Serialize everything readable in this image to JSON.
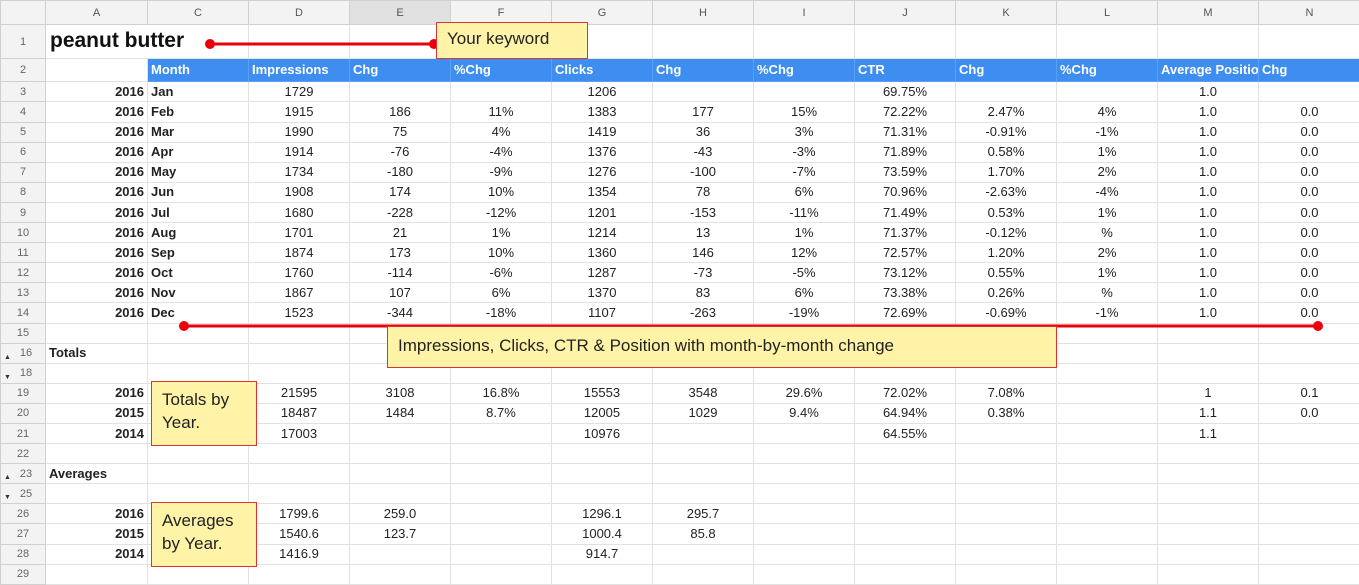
{
  "columns": [
    "A",
    "B",
    "C",
    "D",
    "E",
    "F",
    "G",
    "H",
    "I",
    "J",
    "K",
    "L",
    "M",
    "N"
  ],
  "row_numbers": [
    "1",
    "2",
    "3",
    "4",
    "5",
    "6",
    "7",
    "8",
    "9",
    "10",
    "11",
    "12",
    "13",
    "14",
    "15",
    "16",
    "18",
    "19",
    "20",
    "21",
    "22",
    "23",
    "25",
    "26",
    "27",
    "28",
    "29"
  ],
  "keyword": "peanut butter",
  "headers": [
    "Month",
    "Impressions",
    "Chg",
    "%Chg",
    "Clicks",
    "Chg",
    "%Chg",
    "CTR",
    "Chg",
    "%Chg",
    "Average Position",
    "Chg"
  ],
  "monthly_rows": [
    {
      "year": "2016",
      "month": "Jan",
      "cells": [
        "1729",
        "",
        "",
        "1206",
        "",
        "",
        "69.75%",
        "",
        "",
        "1.0",
        ""
      ]
    },
    {
      "year": "2016",
      "month": "Feb",
      "cells": [
        "1915",
        "186",
        "11%",
        "1383",
        "177",
        "15%",
        "72.22%",
        "2.47%",
        "4%",
        "1.0",
        "0.0"
      ]
    },
    {
      "year": "2016",
      "month": "Mar",
      "cells": [
        "1990",
        "75",
        "4%",
        "1419",
        "36",
        "3%",
        "71.31%",
        "-0.91%",
        "-1%",
        "1.0",
        "0.0"
      ]
    },
    {
      "year": "2016",
      "month": "Apr",
      "cells": [
        "1914",
        "-76",
        "-4%",
        "1376",
        "-43",
        "-3%",
        "71.89%",
        "0.58%",
        "1%",
        "1.0",
        "0.0"
      ]
    },
    {
      "year": "2016",
      "month": "May",
      "cells": [
        "1734",
        "-180",
        "-9%",
        "1276",
        "-100",
        "-7%",
        "73.59%",
        "1.70%",
        "2%",
        "1.0",
        "0.0"
      ]
    },
    {
      "year": "2016",
      "month": "Jun",
      "cells": [
        "1908",
        "174",
        "10%",
        "1354",
        "78",
        "6%",
        "70.96%",
        "-2.63%",
        "-4%",
        "1.0",
        "0.0"
      ]
    },
    {
      "year": "2016",
      "month": "Jul",
      "cells": [
        "1680",
        "-228",
        "-12%",
        "1201",
        "-153",
        "-11%",
        "71.49%",
        "0.53%",
        "1%",
        "1.0",
        "0.0"
      ]
    },
    {
      "year": "2016",
      "month": "Aug",
      "cells": [
        "1701",
        "21",
        "1%",
        "1214",
        "13",
        "1%",
        "71.37%",
        "-0.12%",
        "%",
        "1.0",
        "0.0"
      ]
    },
    {
      "year": "2016",
      "month": "Sep",
      "cells": [
        "1874",
        "173",
        "10%",
        "1360",
        "146",
        "12%",
        "72.57%",
        "1.20%",
        "2%",
        "1.0",
        "0.0"
      ]
    },
    {
      "year": "2016",
      "month": "Oct",
      "cells": [
        "1760",
        "-114",
        "-6%",
        "1287",
        "-73",
        "-5%",
        "73.12%",
        "0.55%",
        "1%",
        "1.0",
        "0.0"
      ]
    },
    {
      "year": "2016",
      "month": "Nov",
      "cells": [
        "1867",
        "107",
        "6%",
        "1370",
        "83",
        "6%",
        "73.38%",
        "0.26%",
        "%",
        "1.0",
        "0.0"
      ]
    },
    {
      "year": "2016",
      "month": "Dec",
      "cells": [
        "1523",
        "-344",
        "-18%",
        "1107",
        "-263",
        "-19%",
        "72.69%",
        "-0.69%",
        "-1%",
        "1.0",
        "0.0"
      ]
    }
  ],
  "totals_label": "Totals",
  "totals_rows": [
    {
      "year": "2016",
      "cells": [
        "21595",
        "3108",
        "16.8%",
        "15553",
        "3548",
        "29.6%",
        "72.02%",
        "7.08%",
        "",
        "1",
        "0.1"
      ]
    },
    {
      "year": "2015",
      "cells": [
        "18487",
        "1484",
        "8.7%",
        "12005",
        "1029",
        "9.4%",
        "64.94%",
        "0.38%",
        "",
        "1.1",
        "0.0"
      ]
    },
    {
      "year": "2014",
      "cells": [
        "17003",
        "",
        "",
        "10976",
        "",
        "",
        "64.55%",
        "",
        "",
        "1.1",
        ""
      ]
    }
  ],
  "averages_label": "Averages",
  "averages_rows": [
    {
      "year": "2016",
      "cells": [
        "1799.6",
        "259.0",
        "",
        "1296.1",
        "295.7",
        "",
        "",
        "",
        "",
        "",
        ""
      ]
    },
    {
      "year": "2015",
      "cells": [
        "1540.6",
        "123.7",
        "",
        "1000.4",
        "85.8",
        "",
        "",
        "",
        "",
        "",
        ""
      ]
    },
    {
      "year": "2014",
      "cells": [
        "1416.9",
        "",
        "",
        "914.7",
        "",
        "",
        "",
        "",
        "",
        "",
        ""
      ]
    }
  ],
  "callouts": {
    "keyword": "Your keyword",
    "monthly": "Impressions, Clicks, CTR & Position with month-by-month change",
    "totals": "Totals by Year.",
    "averages": "Averages by Year."
  },
  "colors": {
    "header_blue": "#3d8ef0",
    "callout_fill": "#fff3a8",
    "annotation_red": "#e8000b"
  }
}
